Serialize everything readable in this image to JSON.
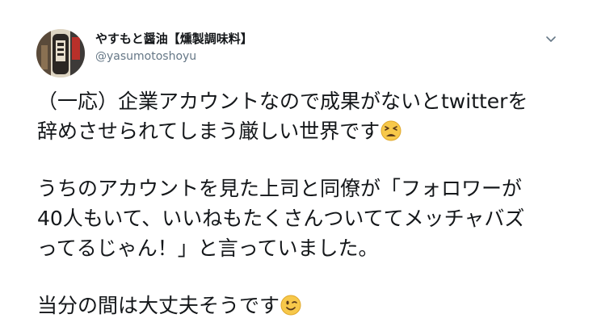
{
  "author": {
    "display_name": "やすもと醤油【燻製調味料】",
    "handle": "@yasumotoshoyu"
  },
  "icons": {
    "more": "chevron-down-icon",
    "emoji_1": "tired-face-emoji-icon",
    "emoji_2": "winking-face-emoji-icon"
  },
  "tweet": {
    "para1_line1": "（一応）企業アカウントなので成果がないとtwitterを",
    "para1_line2": "辞めさせられてしまう厳しい世界です",
    "para2_line1": "うちのアカウントを見た上司と同僚が「フォロワーが",
    "para2_line2": "40人もいて、いいねもたくさんついててメッチャバズ",
    "para2_line3": "ってるじゃん！」と言っていました。",
    "para3_line1": "当分の間は大丈夫そうです"
  },
  "colors": {
    "text": "#14171a",
    "handle": "#657786",
    "emoji_face": "#f7c84a"
  }
}
